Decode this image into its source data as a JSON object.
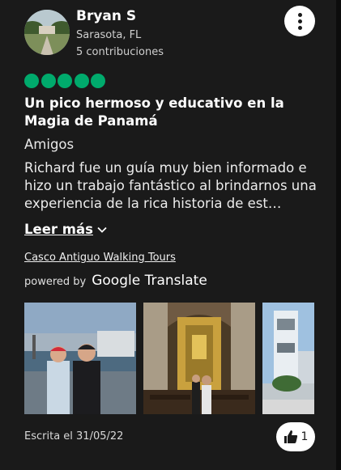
{
  "reviewer": {
    "name": "Bryan S",
    "location": "Sarasota, FL",
    "contributions": "5 contribuciones"
  },
  "rating": {
    "value": 5,
    "max": 5,
    "color": "#00aa6c"
  },
  "review": {
    "title": "Un pico hermoso y educativo en la Magia de Panamá",
    "trip_type": "Amigos",
    "text": "Richard fue un guía muy bien informado e hizo un trabajo fantástico al brindarnos una experiencia de la rica historia de est…",
    "read_more": "Leer más"
  },
  "tour_link": "Casco Antiguo Walking Tours",
  "translation": {
    "powered": "powered by",
    "brand": "Google Translate"
  },
  "photos": [
    {
      "icon": "photo-kids-at-harbor"
    },
    {
      "icon": "photo-church-altar"
    },
    {
      "icon": "photo-bell-tower"
    }
  ],
  "footer": {
    "written": "Escrita el 31/05/22",
    "likes": "1"
  }
}
